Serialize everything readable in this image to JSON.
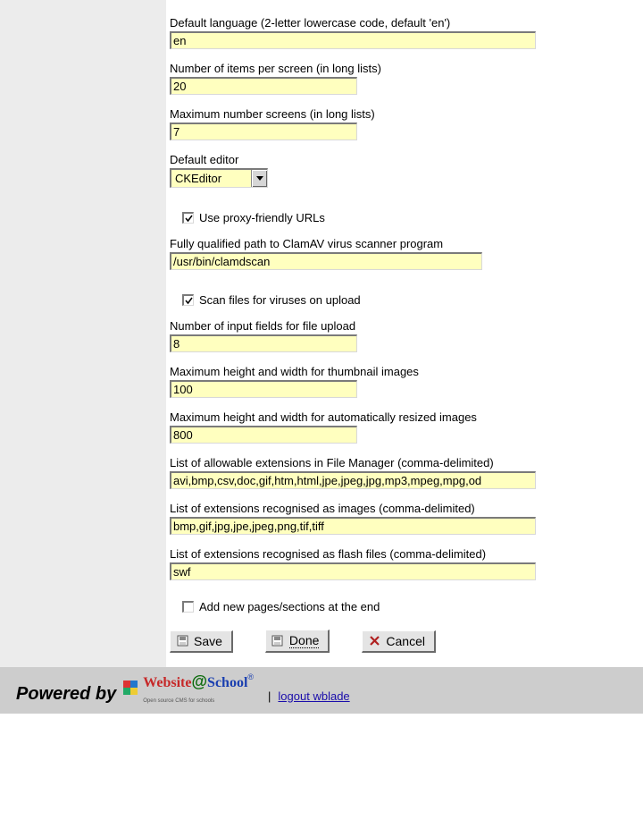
{
  "fields": {
    "defaultLanguage": {
      "label": "Default language (2-letter lowercase code, default 'en')",
      "value": "en"
    },
    "itemsPerScreen": {
      "label": "Number of items per screen (in long lists)",
      "value": "20"
    },
    "maxScreens": {
      "label": "Maximum number screens (in long lists)",
      "value": "7"
    },
    "defaultEditor": {
      "label": "Default editor",
      "value": "CKEditor"
    },
    "proxyFriendly": {
      "label": "Use proxy-friendly URLs",
      "checked": true
    },
    "clamavPath": {
      "label": "Fully qualified path to ClamAV virus scanner program",
      "value": "/usr/bin/clamdscan"
    },
    "scanUpload": {
      "label": "Scan files for viruses on upload",
      "checked": true
    },
    "uploadFields": {
      "label": "Number of input fields for file upload",
      "value": "8"
    },
    "thumbSize": {
      "label": "Maximum height and width for thumbnail images",
      "value": "100"
    },
    "resizeSize": {
      "label": "Maximum height and width for automatically resized images",
      "value": "800"
    },
    "extensions": {
      "label": "List of allowable extensions in File Manager (comma-delimited)",
      "value": "avi,bmp,csv,doc,gif,htm,html,jpe,jpeg,jpg,mp3,mpeg,mpg,od"
    },
    "imageExtensions": {
      "label": "List of extensions recognised as images (comma-delimited)",
      "value": "bmp,gif,jpg,jpe,jpeg,png,tif,tiff"
    },
    "flashExtensions": {
      "label": "List of extensions recognised as flash files (comma-delimited)",
      "value": "swf"
    },
    "addAtEnd": {
      "label": "Add new pages/sections at the end",
      "checked": false
    }
  },
  "buttons": {
    "save": "Save",
    "done": "Done",
    "cancel": "Cancel"
  },
  "footer": {
    "powered": "Powered by",
    "logout": "logout wblade",
    "separator": "|"
  }
}
